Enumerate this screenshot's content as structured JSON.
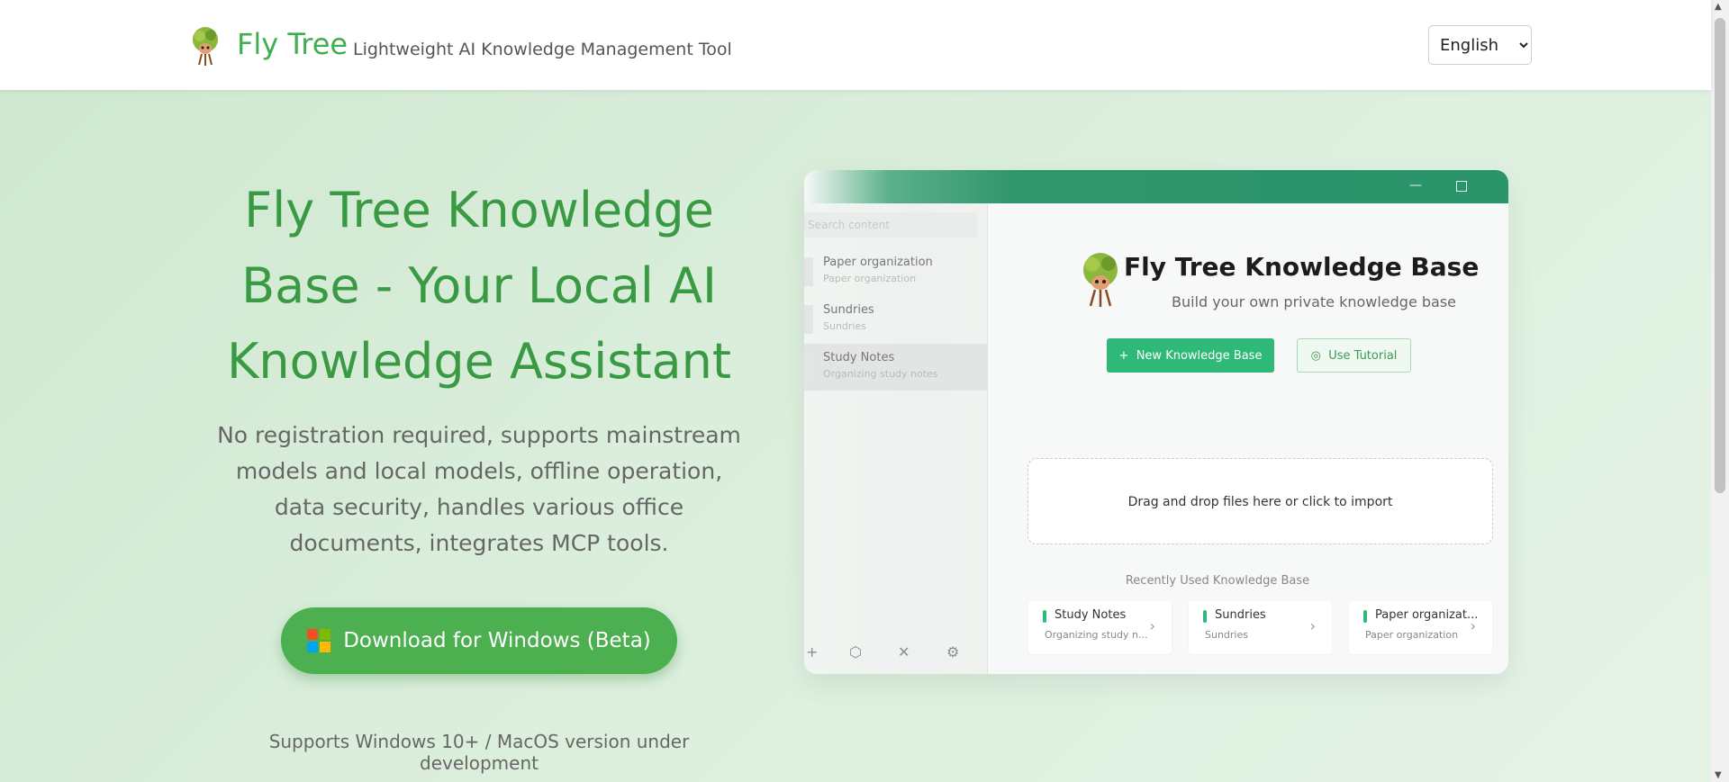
{
  "header": {
    "brand": "Fly Tree",
    "tagline": "Lightweight AI Knowledge Management Tool",
    "language": "English"
  },
  "hero": {
    "title": "Fly Tree Knowledge Base - Your Local AI Knowledge Assistant",
    "description": "No registration required, supports mainstream models and local models, offline operation, data security, handles various office documents, integrates MCP tools.",
    "download_label": "Download for Windows (Beta)",
    "support_note": "Supports Windows 10+ / MacOS version under development"
  },
  "app_preview": {
    "search_placeholder": "Search content",
    "sidebar_items": [
      {
        "title": "Paper organization",
        "sub": "Paper organization"
      },
      {
        "title": "Sundries",
        "sub": "Sundries"
      },
      {
        "title": "Study Notes",
        "sub": "Organizing study notes"
      }
    ],
    "kb_title": "Fly Tree Knowledge Base",
    "kb_subtitle": "Build your own private knowledge base",
    "new_kb_label": "New Knowledge Base",
    "tutorial_label": "Use Tutorial",
    "dropzone_text": "Drag and drop files here or click to import",
    "recent_heading": "Recently Used Knowledge Base",
    "recent_items": [
      {
        "title": "Study Notes",
        "sub": "Organizing study n..."
      },
      {
        "title": "Sundries",
        "sub": "Sundries"
      },
      {
        "title": "Paper organizat...",
        "sub": "Paper organization"
      }
    ]
  },
  "colors": {
    "brand_green": "#3fae4f",
    "download_button": "#4caf50",
    "app_accent": "#2fb978",
    "titlebar": "#2a946b"
  }
}
